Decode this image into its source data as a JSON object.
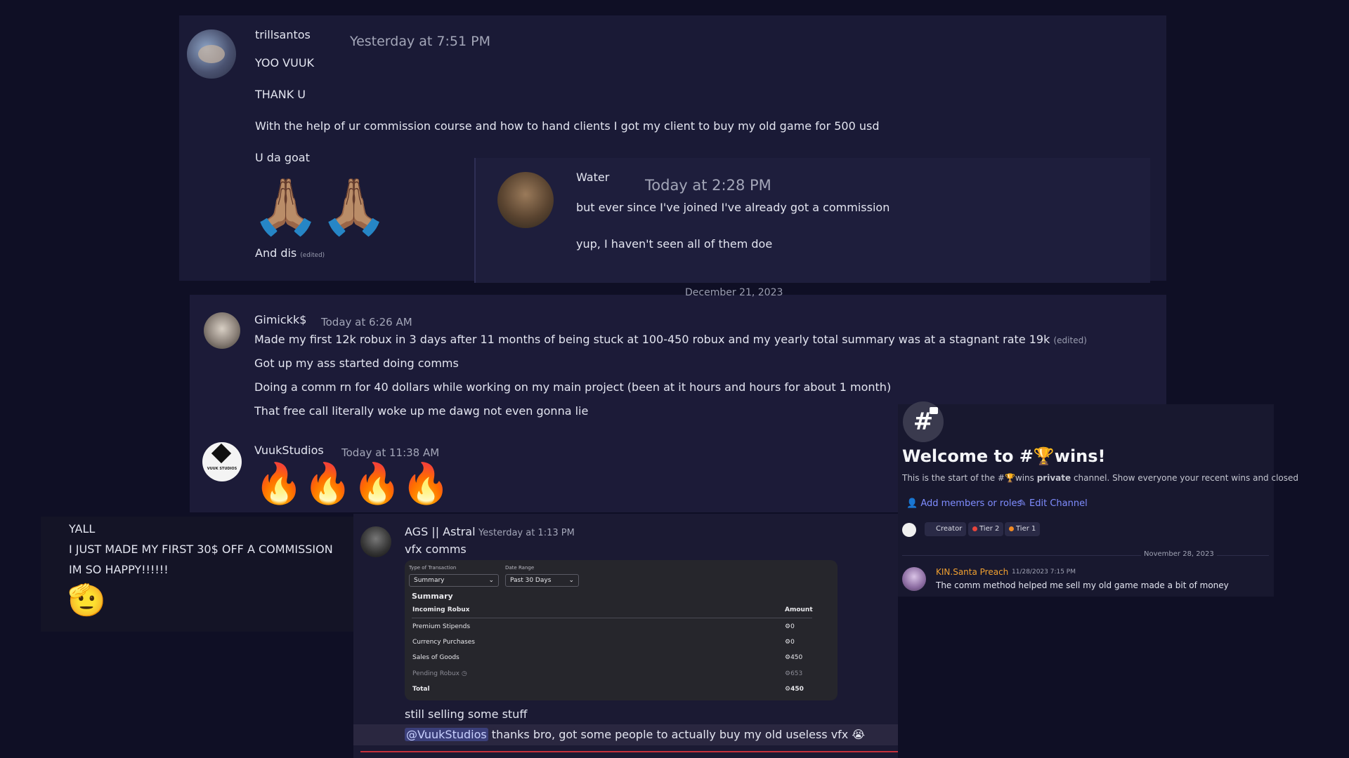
{
  "trill": {
    "author": "trillsantos",
    "timestamp": "Yesterday at 7:51 PM",
    "lines": [
      "YOO VUUK",
      "THANK U",
      "With the help of ur commission course and how to hand clients I got my client to buy my old game for 500 usd",
      "U da goat"
    ],
    "emoji": "🙏🏽🙏🏽",
    "last_line": "And dis",
    "edited": "(edited)"
  },
  "water": {
    "author": "Water",
    "timestamp": "Today at 2:28 PM",
    "lines": [
      "but ever since I've joined I've already got a commission",
      "yup, I haven't seen all of them doe"
    ]
  },
  "divider_date": "December 21, 2023",
  "gimick": {
    "author": "Gimickk$",
    "timestamp": "Today at 6:26 AM",
    "lines": [
      "Made my first 12k robux in 3 days after 11 months of being stuck at 100-450 robux and my yearly  total summary was at a stagnant rate 19k",
      "Got up my ass started doing comms",
      "Doing a comm rn for 40 dollars while working on my main project (been at it hours and hours for about 1 month)",
      "That free call literally woke up me dawg not even gonna lie"
    ],
    "edited": "(edited)"
  },
  "vuuk": {
    "author": "VuukStudios",
    "timestamp": "Today at 11:38 AM",
    "emoji": "🔥",
    "avatar_text": "VUUK STUDIOS"
  },
  "yall": {
    "lines": [
      "YALL",
      "I JUST MADE MY FIRST 30$ OFF A COMMISSION",
      "IM SO HAPPY!!!!!!"
    ],
    "emoji": "🫡"
  },
  "ags": {
    "author": "AGS || Astral",
    "timestamp": "Yesterday at 1:13 PM",
    "line1": "vfx comms",
    "line2": "still selling some stuff",
    "mention": "@VuukStudios",
    "line3": "thanks bro, got some people to actually buy my old useless vfx",
    "line3_emoji": "😭"
  },
  "summary": {
    "type_label": "Type of Transaction",
    "type_value": "Summary",
    "date_label": "Date Range",
    "date_value": "Past 30 Days",
    "heading": "Summary",
    "col_left": "Incoming Robux",
    "col_right": "Amount",
    "rows": [
      {
        "label": "Premium Stipends",
        "value": "0"
      },
      {
        "label": "Currency Purchases",
        "value": "0"
      },
      {
        "label": "Sales of Goods",
        "value": "450"
      },
      {
        "label": "Pending Robux",
        "value": "653"
      },
      {
        "label": "Total",
        "value": "450"
      }
    ]
  },
  "wins": {
    "icon": "#",
    "title": "Welcome to #🏆wins!",
    "desc_1": "This is the start of the #🏆wins ",
    "desc_bold": "private",
    "desc_2": " channel. Show everyone your recent wins and closed",
    "add_members": "Add members or roles",
    "edit_channel": "Edit Channel",
    "chips": [
      "Creator",
      "Tier 2",
      "Tier 1"
    ],
    "date": "November 28, 2023",
    "author": "KIN.Santa Preach",
    "timestamp": "11/28/2023 7:15 PM",
    "text": "The comm method helped me sell my old game made a bit of money"
  },
  "colors": {
    "background": "#0f0f25",
    "water_name": "#f0902c",
    "ags_name": "#e8453c",
    "santa_name": "#f0a030",
    "link": "#7f8dff",
    "tier2": "#e8453c",
    "tier1": "#f08a24"
  }
}
